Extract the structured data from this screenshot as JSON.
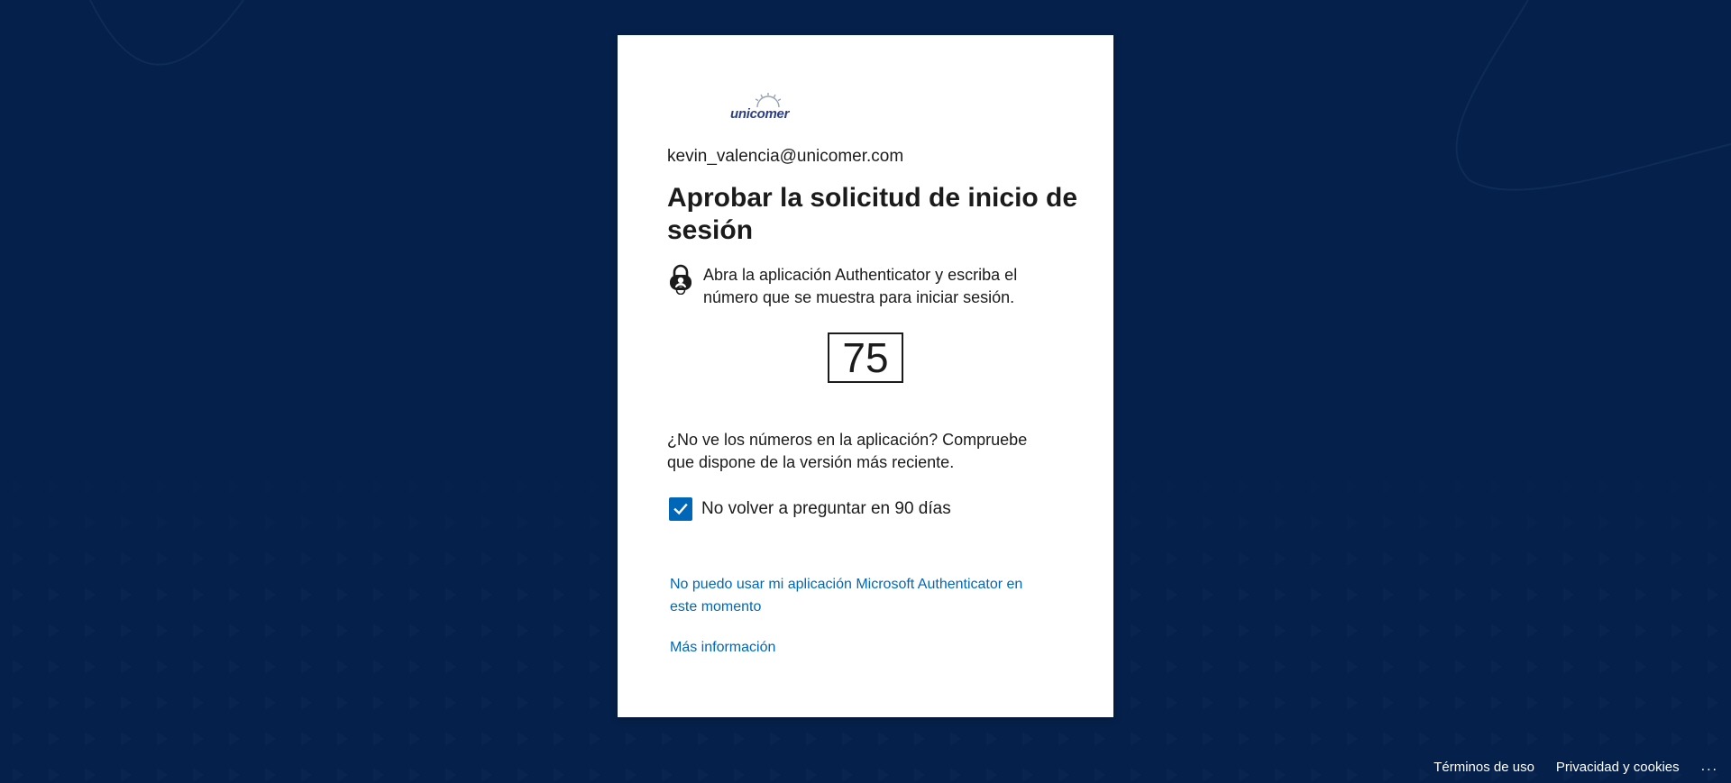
{
  "brand": {
    "logo_text": "unicomer",
    "logo_color": "#2d3f86"
  },
  "colors": {
    "background": "#05204a",
    "accent": "#0067b8",
    "card": "#ffffff"
  },
  "identity": {
    "email": "kevin_valencia@unicomer.com"
  },
  "page": {
    "title": "Aprobar la solicitud de inicio de sesión",
    "instruction": "Abra la aplicación Authenticator y escriba el número que se muestra para iniciar sesión.",
    "instruction_icon": "authenticator-lock-icon",
    "display_number": "75",
    "help_text": "¿No ve los números en la aplicación? Compruebe que dispone de la versión más reciente."
  },
  "remember": {
    "checked": true,
    "label": "No volver a preguntar en 90 días"
  },
  "links": {
    "cannot_use_app": "No puedo usar mi aplicación Microsoft Authenticator en este momento",
    "more_info": "Más información"
  },
  "footer": {
    "terms": "Términos de uso",
    "privacy": "Privacidad y cookies",
    "more": "..."
  }
}
